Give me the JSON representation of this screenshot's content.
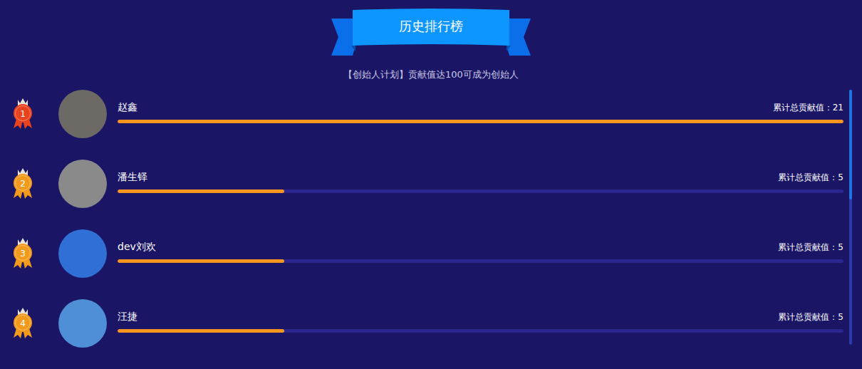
{
  "header": {
    "title": "历史排行榜",
    "subtitle": "【创始人计划】贡献值达100可成为创始人"
  },
  "rows": [
    {
      "rank": "1",
      "name": "赵鑫",
      "reading": "累计总贡献值：21",
      "level": 1.0,
      "color": "#e8431e"
    },
    {
      "rank": "2",
      "name": "潘生铎",
      "reading": "累计总贡献值：5",
      "level": 0.23,
      "color": "#f29a1c"
    },
    {
      "rank": "3",
      "name": "dev刘欢",
      "reading": "累计总贡献值：5",
      "level": 0.23,
      "color": "#f29a1c"
    },
    {
      "rank": "4",
      "name": "汪捷",
      "reading": "累计总贡献值：5",
      "level": 0.23,
      "color": "#f29a1c"
    }
  ],
  "scrollbar": {
    "thumb": 0.43,
    "position": 0
  }
}
